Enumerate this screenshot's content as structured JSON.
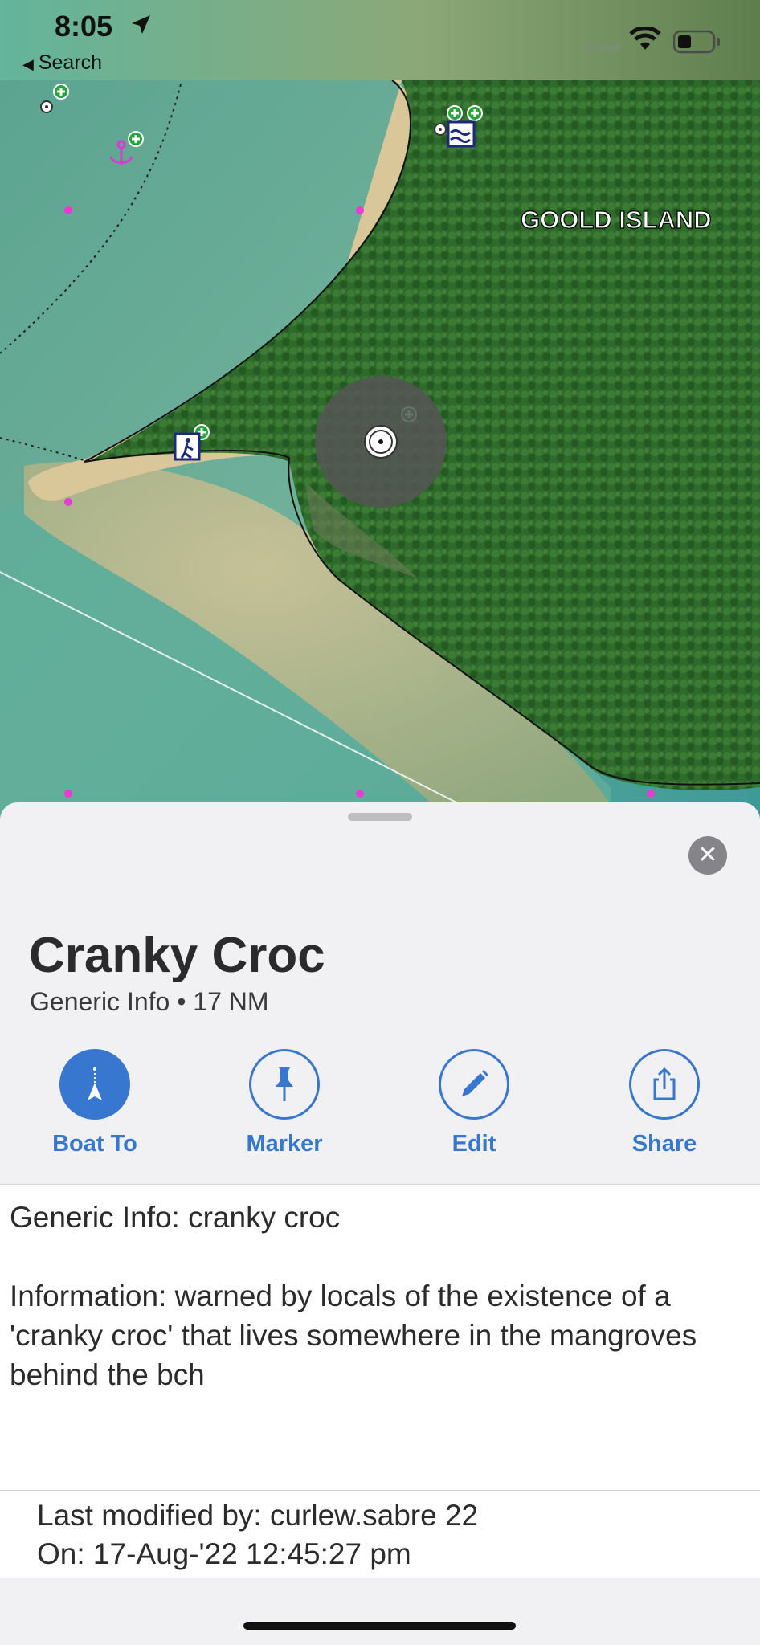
{
  "status_bar": {
    "time": "8:05",
    "back_label": "Search"
  },
  "map": {
    "island_label": "GOOLD ISLAND"
  },
  "sheet": {
    "close_label": "✕",
    "title": "Cranky Croc",
    "subtitle": "Generic Info • 17 NM",
    "actions": [
      {
        "label": "Boat To",
        "icon": "boat-icon"
      },
      {
        "label": "Marker",
        "icon": "pin-icon"
      },
      {
        "label": "Edit",
        "icon": "pencil-icon"
      },
      {
        "label": "Share",
        "icon": "share-icon"
      }
    ],
    "info": {
      "line1": "Generic Info: cranky croc",
      "line2": "Information: warned by locals of the existence of a 'cranky croc' that lives somewhere in the mangroves behind the bch"
    },
    "footer": {
      "modified_by": "Last modified by: curlew.sabre 22",
      "modified_on": "On: 17-Aug-'22 12:45:27 pm"
    }
  },
  "colors": {
    "accent": "#3777cf",
    "water": "#3a9c96",
    "sand": "#cfb98a",
    "forest": "#2f6a2a"
  }
}
